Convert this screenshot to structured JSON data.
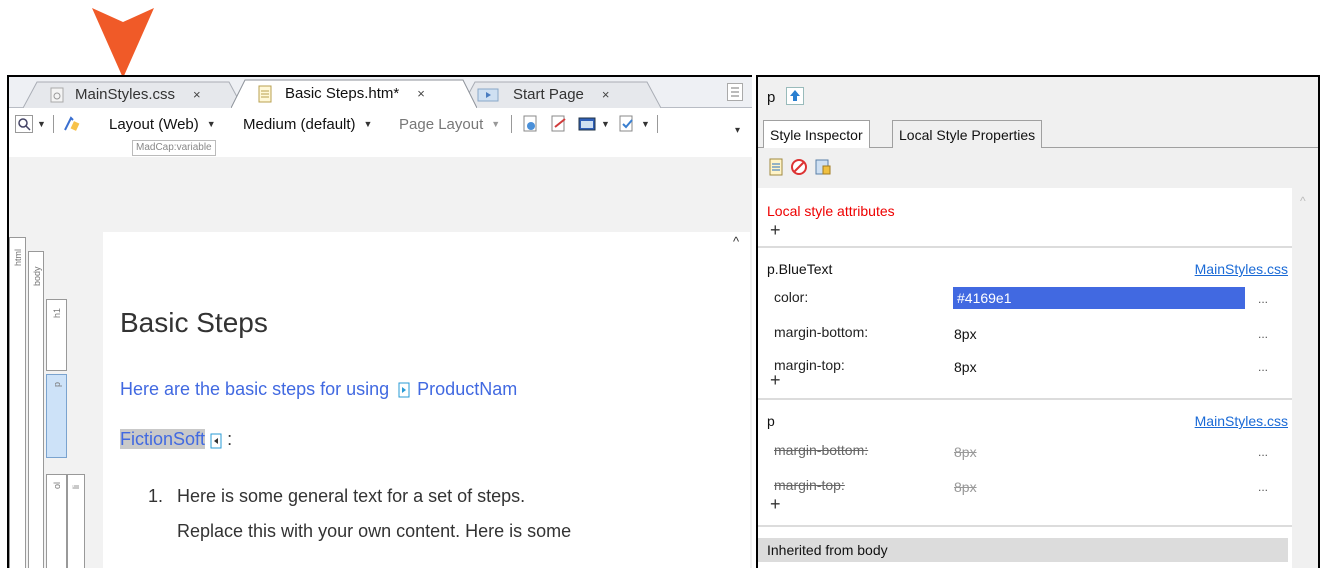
{
  "tabs": [
    {
      "title": "MainStyles.css",
      "close": "×",
      "icon": "css-file-icon",
      "active": false
    },
    {
      "title": "Basic Steps.htm*",
      "close": "×",
      "icon": "html-file-icon",
      "active": true
    },
    {
      "title": "Start Page",
      "close": "×",
      "icon": "start-page-icon",
      "active": false
    }
  ],
  "toolbar": {
    "layout_label": "Layout (Web)",
    "medium_label": "Medium (default)",
    "page_layout_label": "Page Layout"
  },
  "editor": {
    "variable_label": "MadCap:variable",
    "struct_labels": {
      "html": "html",
      "body": "body",
      "h1": "h1",
      "p": "p",
      "ol": "ol",
      "li": "li"
    },
    "heading": "Basic Steps",
    "para_text": "Here are the basic steps for using",
    "variable_text": "ProductNam",
    "fiction_text": "FictionSoft",
    "fiction_suffix": ":",
    "list_number": "1.",
    "list_line1": "Here is some general text for a set of steps.",
    "list_line2": "Replace this with your own content. Here is some"
  },
  "panel": {
    "tag": "p",
    "tabs": [
      "Style Inspector",
      "Local Style Properties"
    ],
    "local_attr_label": "Local style attributes",
    "add": "+",
    "rules": [
      {
        "selector": "p.BlueText",
        "source": "MainStyles.css",
        "props": [
          {
            "name": "color:",
            "value": "#4169e1",
            "ellipsis": "..."
          },
          {
            "name": "margin-bottom:",
            "value": "8px",
            "ellipsis": "..."
          },
          {
            "name": "margin-top:",
            "value": "8px",
            "ellipsis": "..."
          }
        ]
      },
      {
        "selector": "p",
        "source": "MainStyles.css",
        "props": [
          {
            "name": "margin-bottom:",
            "value": "8px",
            "ellipsis": "..."
          },
          {
            "name": "margin-top:",
            "value": "8px",
            "ellipsis": "..."
          }
        ]
      }
    ],
    "inherited_label": "Inherited from body"
  },
  "colors": {
    "accent": "#4169e1",
    "callout": "#f05a28",
    "link": "#1a6ad6",
    "local_attr": "#e00000"
  }
}
